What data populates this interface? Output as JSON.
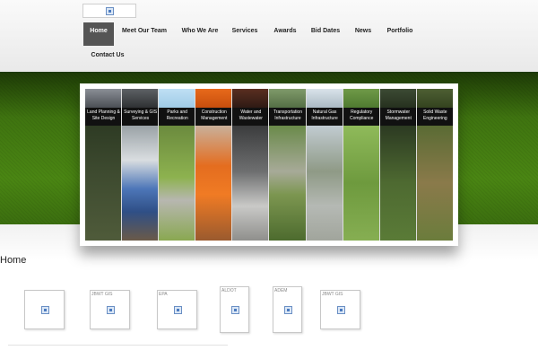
{
  "nav": {
    "items": [
      {
        "label": "Home",
        "active": true
      },
      {
        "label": "Meet Our Team"
      },
      {
        "label": "Who We Are"
      },
      {
        "label": "Services"
      },
      {
        "label": "Awards"
      },
      {
        "label": "Bid Dates"
      },
      {
        "label": "News"
      },
      {
        "label": "Portfolio"
      },
      {
        "label": "Contact Us"
      }
    ]
  },
  "slider": {
    "panels": [
      {
        "label": "Land Planning & Site Design"
      },
      {
        "label": "Surveying & GIS Services"
      },
      {
        "label": "Parks and Recreation"
      },
      {
        "label": "Construction Management"
      },
      {
        "label": "Water and Wastewater"
      },
      {
        "label": "Transportation Infrastructure"
      },
      {
        "label": "Natural Gas Infrastructure"
      },
      {
        "label": "Regulatory Compliance"
      },
      {
        "label": "Stormwater Management"
      },
      {
        "label": "Solid Waste Engineering"
      }
    ]
  },
  "page": {
    "title": "Home"
  },
  "thumbnails": [
    {
      "label": ""
    },
    {
      "label": "JBWT GIS"
    },
    {
      "label": "EPA"
    },
    {
      "label": "ALDOT"
    },
    {
      "label": "ADEM"
    },
    {
      "label": "JBWT GIS"
    }
  ],
  "colors": {
    "nav_active_bg": "#555555",
    "banner_green": "#4a8613",
    "label_bar": "#111111"
  },
  "icons": {
    "broken_image": "broken-image-icon"
  }
}
